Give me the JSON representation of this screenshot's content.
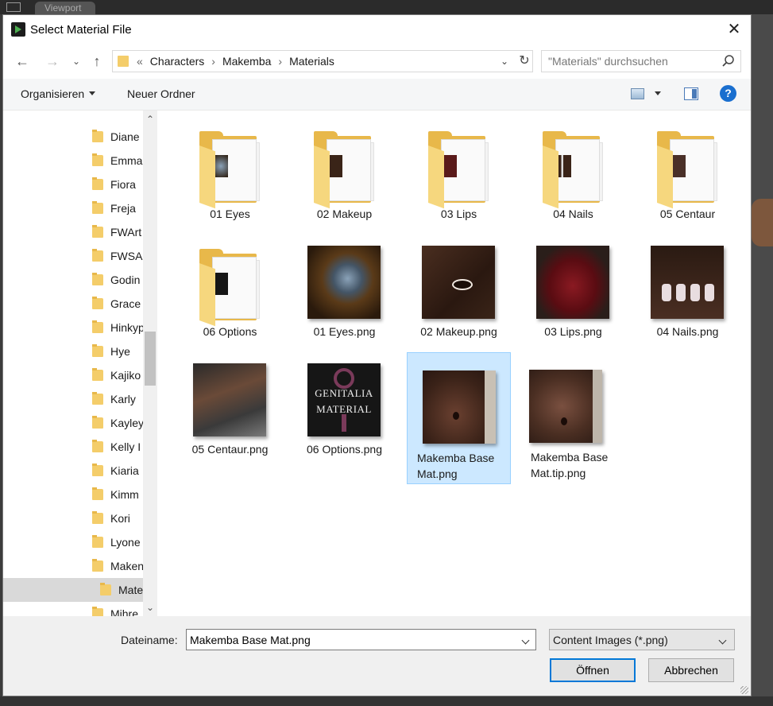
{
  "background": {
    "viewport_tab": "Viewport"
  },
  "dialog": {
    "title": "Select Material File",
    "close_symbol": "✕"
  },
  "nav": {
    "back_symbol": "←",
    "forward_symbol": "→",
    "recent_symbol": "⌄",
    "up_symbol": "↑",
    "overflow_symbol": "«",
    "breadcrumbs": [
      "Characters",
      "Makemba",
      "Materials"
    ],
    "crumb_separator": "›",
    "dropdown_symbol": "⌄",
    "refresh_symbol": "↻"
  },
  "search": {
    "placeholder": "\"Materials\" durchsuchen"
  },
  "commandbar": {
    "organize": "Organisieren",
    "new_folder": "Neuer Ordner",
    "help": "?"
  },
  "navpane": {
    "items": [
      {
        "label": "Diane"
      },
      {
        "label": "Emma"
      },
      {
        "label": "Fiora"
      },
      {
        "label": "Freja"
      },
      {
        "label": "FWArt"
      },
      {
        "label": "FWSA"
      },
      {
        "label": "Godin"
      },
      {
        "label": "Grace"
      },
      {
        "label": "Hinkyp"
      },
      {
        "label": "Hye"
      },
      {
        "label": "Kajiko"
      },
      {
        "label": "Karly"
      },
      {
        "label": "Kayley"
      },
      {
        "label": "Kelly I"
      },
      {
        "label": "Kiaria"
      },
      {
        "label": "Kimm"
      },
      {
        "label": "Kori"
      },
      {
        "label": "Lyone"
      },
      {
        "label": "Maken"
      },
      {
        "label": "Mate",
        "selected": true,
        "sub": true
      },
      {
        "label": "Mihre"
      }
    ],
    "scroll_up": "⌃",
    "scroll_down": "⌄"
  },
  "files": [
    {
      "name": "01 Eyes",
      "kind": "folder"
    },
    {
      "name": "02 Makeup",
      "kind": "folder"
    },
    {
      "name": "03 Lips",
      "kind": "folder"
    },
    {
      "name": "04 Nails",
      "kind": "folder"
    },
    {
      "name": "05 Centaur",
      "kind": "folder"
    },
    {
      "name": "06 Options",
      "kind": "folder"
    },
    {
      "name": "01 Eyes.png",
      "kind": "image"
    },
    {
      "name": "02 Makeup.png",
      "kind": "image"
    },
    {
      "name": "03 Lips.png",
      "kind": "image"
    },
    {
      "name": "04 Nails.png",
      "kind": "image"
    },
    {
      "name": "05 Centaur.png",
      "kind": "image"
    },
    {
      "name": "06 Options.png",
      "kind": "image",
      "thumb_text": [
        "GENITALIA",
        "MATERIAL"
      ]
    },
    {
      "name": "Makemba Base Mat.png",
      "kind": "image",
      "selected": true,
      "label_lines": [
        "Makemba Base",
        "Mat.png"
      ]
    },
    {
      "name": "Makemba Base Mat.tip.png",
      "kind": "image",
      "label_lines": [
        "Makemba Base",
        "Mat.tip.png"
      ]
    }
  ],
  "footer": {
    "filename_label": "Dateiname:",
    "filename_value": "Makemba Base Mat.png",
    "filetype": "Content Images (*.png)",
    "open": "Öffnen",
    "cancel": "Abbrechen"
  }
}
